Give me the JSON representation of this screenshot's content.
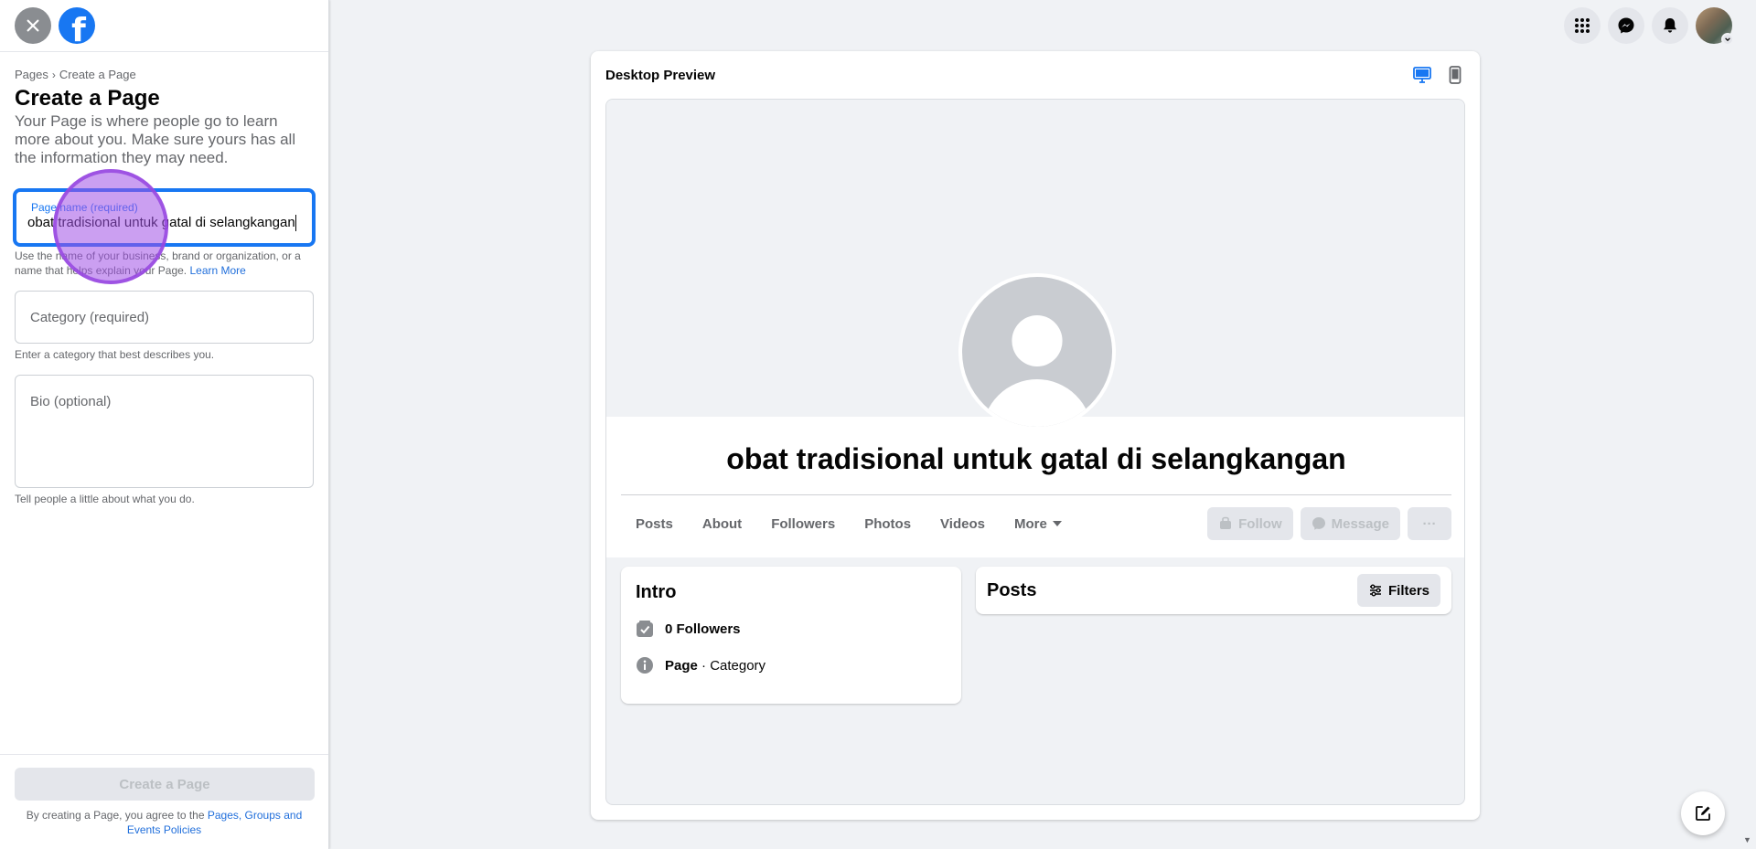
{
  "left_panel": {
    "breadcrumb": {
      "parent": "Pages",
      "separator": "›",
      "current": "Create a Page"
    },
    "title": "Create a Page",
    "description": "Your Page is where people go to learn more about you. Make sure yours has all the information they may need.",
    "page_name_field": {
      "label": "Page name (required)",
      "value": "obat tradisional untuk gatal di selangkangan",
      "helper": "Use the name of your business, brand or organization, or a name that helps explain your Page.",
      "helper_link": "Learn More"
    },
    "category_field": {
      "placeholder": "Category (required)",
      "helper": "Enter a category that best describes you."
    },
    "bio_field": {
      "placeholder": "Bio (optional)",
      "helper": "Tell people a little about what you do."
    },
    "create_button": "Create a Page",
    "terms_prefix": "By creating a Page, you agree to the",
    "terms_link": "Pages, Groups and Events Policies"
  },
  "top_icons": [
    "menu-grid-icon",
    "messenger-icon",
    "bell-icon",
    "avatar"
  ],
  "preview": {
    "title": "Desktop Preview",
    "page_name": "obat tradisional untuk gatal di selangkangan",
    "tabs": [
      "Posts",
      "About",
      "Followers",
      "Photos",
      "Videos",
      "More"
    ],
    "actions": {
      "follow": "Follow",
      "message": "Message",
      "more": "···"
    },
    "intro": {
      "title": "Intro",
      "followers": "0 Followers",
      "page_label": "Page",
      "category_text": " · Category"
    },
    "posts": {
      "title": "Posts",
      "filters": "Filters"
    }
  },
  "colors": {
    "accent": "#1877f2",
    "link": "#216fdb",
    "bg": "#f0f2f5",
    "touch": "#a050e6"
  }
}
